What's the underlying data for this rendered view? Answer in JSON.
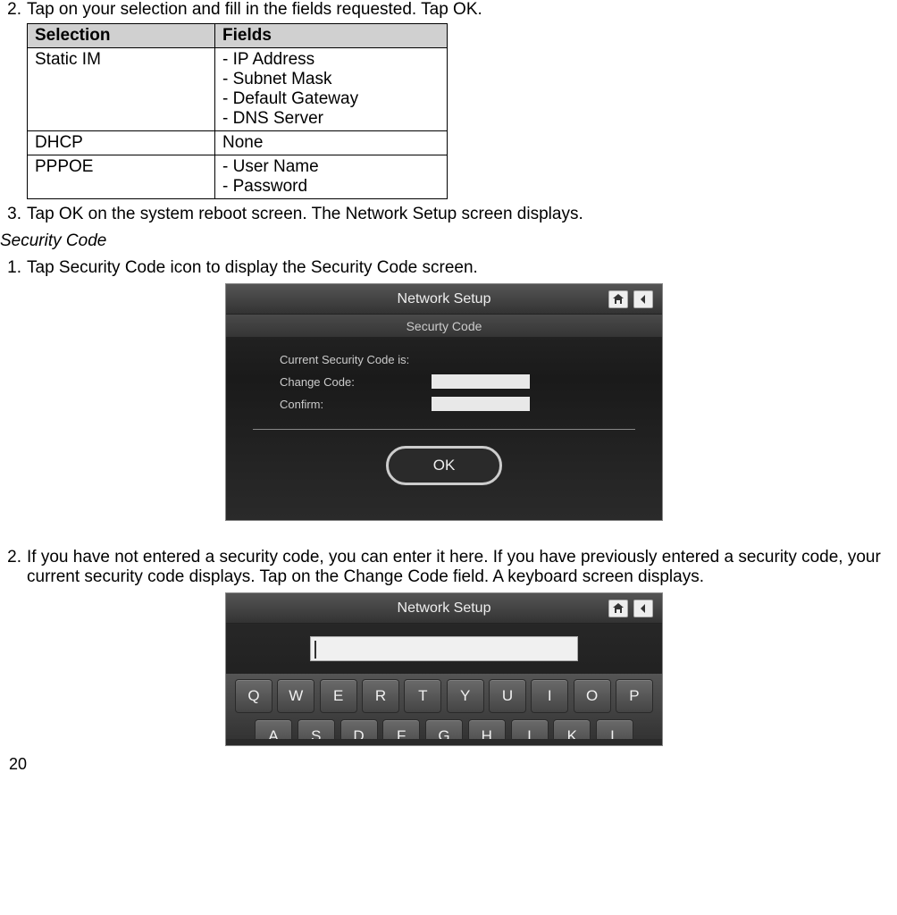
{
  "steps_a": [
    {
      "num": "2.",
      "text": "Tap on your selection and fill in the fields requested. Tap OK."
    },
    {
      "num": "3.",
      "text": "Tap OK on the system reboot screen. The Network Setup screen displays."
    }
  ],
  "section_heading": "Security Code",
  "steps_b": [
    {
      "num": "1.",
      "text": "Tap Security Code icon to display the Security Code screen."
    },
    {
      "num": "2.",
      "text": "If you have not entered a security code, you can enter it here. If you have previously entered a security code, your current security code displays. Tap on the Change Code field. A keyboard screen displays."
    }
  ],
  "table": {
    "headers": [
      "Selection",
      "Fields"
    ],
    "rows": [
      {
        "selection": "Static IM",
        "fields": [
          "- IP Address",
          "- Subnet Mask",
          "- Default Gateway",
          "- DNS Server"
        ]
      },
      {
        "selection": "DHCP",
        "fields": [
          "None"
        ]
      },
      {
        "selection": "PPPOE",
        "fields": [
          "- User Name",
          "- Password"
        ]
      }
    ]
  },
  "security_screen": {
    "title": "Network Setup",
    "subtitle": "Securty Code",
    "label_current": "Current Security Code is:",
    "label_change": "Change Code:",
    "label_confirm": "Confirm:",
    "ok": "OK"
  },
  "keyboard_screen": {
    "title": "Network Setup",
    "row1": [
      "Q",
      "W",
      "E",
      "R",
      "T",
      "Y",
      "U",
      "I",
      "O",
      "P"
    ],
    "row2": [
      "A",
      "S",
      "D",
      "F",
      "G",
      "H",
      "I",
      "K",
      "L"
    ]
  },
  "page_number": "20"
}
